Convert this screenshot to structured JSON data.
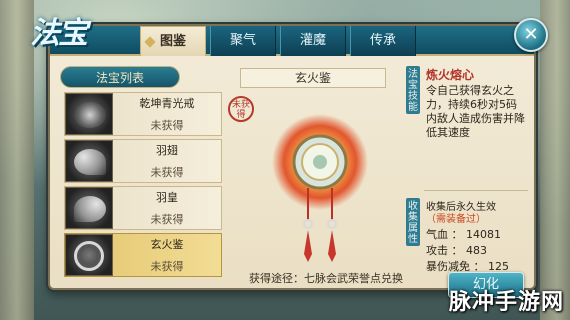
{
  "logo": "法宝",
  "tabs": [
    {
      "label": "图鉴",
      "active": true
    },
    {
      "label": "聚气",
      "active": false
    },
    {
      "label": "灌魔",
      "active": false
    },
    {
      "label": "传承",
      "active": false
    }
  ],
  "close_icon": "close-icon",
  "list_header": "法宝列表",
  "items": [
    {
      "name": "乾坤青光戒",
      "status": "未获得",
      "icon": "ring-icon"
    },
    {
      "name": "羽翅",
      "status": "未获得",
      "icon": "wing-icon"
    },
    {
      "name": "羽皇",
      "status": "未获得",
      "icon": "wing-icon"
    },
    {
      "name": "玄火鉴",
      "status": "未获得",
      "icon": "mirror-icon",
      "selected": true
    }
  ],
  "center": {
    "title": "玄火鉴",
    "seal_text": "未获得",
    "acquire_text": "获得途径：七脉会武荣誉点兑换"
  },
  "skill": {
    "label": "法宝技能",
    "name": "炼火熔心",
    "description": "令自己获得玄火之力，持续6秒对5码内敌人造成伤害并降低其速度"
  },
  "collection": {
    "label": "收集属性",
    "title": "收集后永久生效",
    "subtitle": "（需装备过）",
    "stats": [
      {
        "name": "气血",
        "value": "14081"
      },
      {
        "name": "攻击",
        "value": "483"
      },
      {
        "name": "暴伤减免",
        "value": "125"
      }
    ]
  },
  "transform_button": "幻化",
  "watermark": "脉冲手游网",
  "colors": {
    "accent_teal": "#1f6f86",
    "gold_border": "#c7b074",
    "skill_red": "#b2352a"
  }
}
